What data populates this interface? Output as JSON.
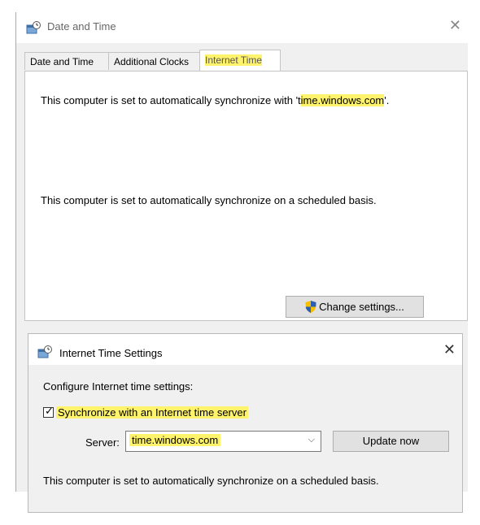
{
  "main_window": {
    "title": "Date and Time",
    "close_glyph": "✕",
    "tabs": [
      {
        "label": "Date and Time"
      },
      {
        "label": "Additional Clocks"
      },
      {
        "label": "Internet Time",
        "active": true
      }
    ],
    "panel": {
      "sync_text_prefix": "This computer is set to automatically synchronize with 't",
      "sync_text_server": "ime.windows.com",
      "sync_text_suffix": "'.",
      "schedule_text": "This computer is set to automatically synchronize on a scheduled basis.",
      "change_settings_label": "Change settings...",
      "change_settings_icon": "uac-shield-icon"
    }
  },
  "dialog": {
    "title": "Internet Time Settings",
    "close_glyph": "✕",
    "configure_label": "Configure Internet time settings:",
    "sync_checkbox": {
      "label": "Synchronize with an Internet time server",
      "checked": true
    },
    "server_label": "Server:",
    "server_value": "time.windows.com",
    "update_now_label": "Update now",
    "status_text": "This computer is set to automatically synchronize on a scheduled basis."
  },
  "colors": {
    "highlight": "#fff36b",
    "window_bg": "#f0f0f0",
    "button_bg": "#e1e1e1"
  }
}
